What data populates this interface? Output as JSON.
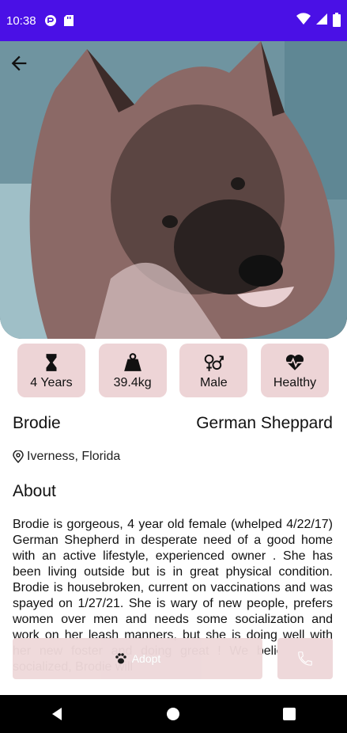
{
  "status_bar": {
    "time": "10:38",
    "left_icons": [
      "cast-icon",
      "sd-card-icon"
    ],
    "right_icons": [
      "wifi-icon",
      "signal-icon",
      "battery-icon"
    ],
    "color": "#4a10e6"
  },
  "hero": {
    "image": "dog-photo",
    "back_icon": "back-arrow-icon"
  },
  "chips": [
    {
      "icon": "hourglass-icon",
      "label": "4 Years"
    },
    {
      "icon": "weight-icon",
      "label": "39.4kg"
    },
    {
      "icon": "gender-icon",
      "label": "Male"
    },
    {
      "icon": "heart-pulse-icon",
      "label": "Healthy"
    }
  ],
  "pet": {
    "name": "Brodie",
    "breed": "German Sheppard",
    "location": "Iverness, Florida"
  },
  "about": {
    "heading": "About",
    "text": "Brodie is gorgeous, 4 year old female (whelped 4/22/17) German Shepherd in desperate need of a good home with an active lifestyle, experienced owner . She has been living outside but is in great physical condition. Brodie is housebroken, current on vaccinations and was spayed on 1/27/21. She is wary of new people, prefers women over men and needs some socialization and work on her leash manners, but she is doing well with her new foster and doing great ! We believe once socialized, Brodie will"
  },
  "actions": {
    "adopt_label": "Adopt",
    "adopt_icon": "paw-icon",
    "call_icon": "phone-icon",
    "button_color": "#eed8da"
  },
  "nav_bar": {
    "icons": [
      "nav-back-icon",
      "nav-home-icon",
      "nav-recents-icon"
    ]
  }
}
